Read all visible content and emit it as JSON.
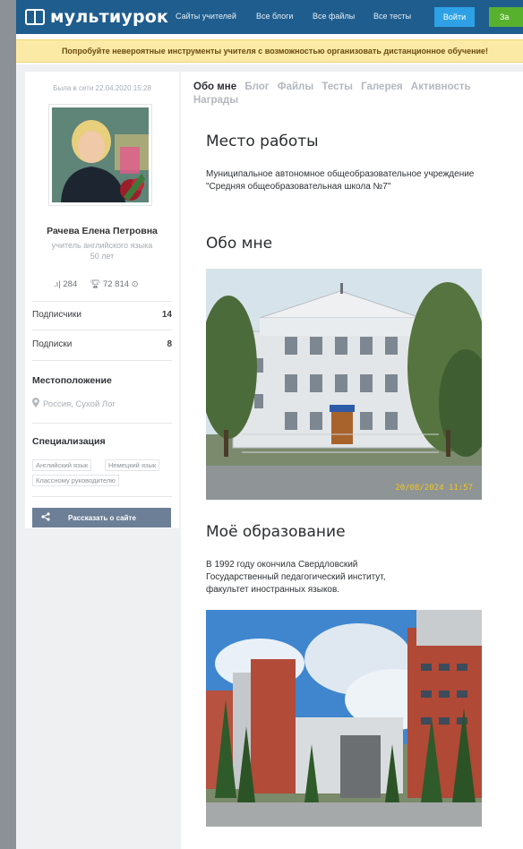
{
  "header": {
    "logo": "мультиурок",
    "nav": [
      "Сайты учителей",
      "Все блоги",
      "Все файлы",
      "Все тесты"
    ],
    "login": "Войти",
    "register": "За"
  },
  "promo": "Попробуйте невероятные инструменты учителя с возможностью организовать дистанционное обучение!",
  "profile": {
    "last_online": "Была в сети 22.04.2020 15:28",
    "name": "Рачева Елена Петровна",
    "role": "учитель английского языка",
    "age": "50 лет",
    "rating": "284",
    "awards": "72 814",
    "subscribers_label": "Подписчики",
    "subscribers_count": "14",
    "subscriptions_label": "Подписки",
    "subscriptions_count": "8",
    "location_heading": "Местоположение",
    "location": "Россия, Сухой Лог",
    "spec_heading": "Специализация",
    "tags": [
      "Английский язык",
      "Немецкий язык",
      "Классному руководителю"
    ],
    "share": "Рассказать о сайте"
  },
  "tabs": [
    "Обо мне",
    "Блог",
    "Файлы",
    "Тесты",
    "Галерея",
    "Активность",
    "Награды"
  ],
  "content": {
    "work_heading": "Место работы",
    "work_text": "Муниципальное автономное общеобразовательное учреждение \"Средняя общеобразовательная школа №7\"",
    "about_heading": "Обо мне",
    "photo1_stamp": "20/08/2024 11:57",
    "edu_heading": "Моё образование",
    "edu_text": "В 1992 году окончила Свердловский Государственный педагогический институт, факультет иностранных языков."
  },
  "colors": {
    "header": "#1f5d8e",
    "login_button": "#2ea1e6",
    "register_button": "#58b12d",
    "promo_bg": "#fbeaa6",
    "share_button": "#6c7f96"
  }
}
